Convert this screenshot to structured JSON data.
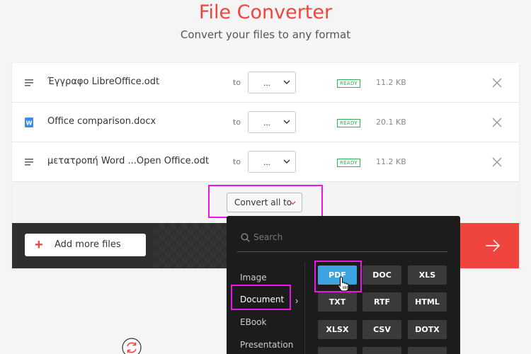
{
  "header": {
    "title": "File Converter",
    "subtitle": "Convert your files to any format"
  },
  "files": [
    {
      "name": "Έγγραφο LibreOffice.odt",
      "icon": "document-icon",
      "to_label": "to",
      "format": "...",
      "status": "READY",
      "size": "11.2 KB"
    },
    {
      "name": "Office comparison.docx",
      "icon": "word-icon",
      "to_label": "to",
      "format": "...",
      "status": "READY",
      "size": "20.1 KB"
    },
    {
      "name": "μετατροπή Word ...Open Office.odt",
      "icon": "document-icon",
      "to_label": "to",
      "format": "...",
      "status": "READY",
      "size": "11.2 KB"
    }
  ],
  "convert_all": {
    "label": "Convert all to"
  },
  "add_more": {
    "label": "Add more files"
  },
  "dropdown": {
    "search_placeholder": "Search",
    "categories": [
      "Image",
      "Document",
      "EBook",
      "Presentation"
    ],
    "active_category": "Document",
    "formats": [
      "PDF",
      "DOC",
      "XLS",
      "TXT",
      "RTF",
      "HTML",
      "XLSX",
      "CSV",
      "DOTX"
    ],
    "selected_format": "PDF"
  },
  "colors": {
    "brand": "#f0443f",
    "ready": "#2fae52",
    "selected": "#3aa3e0",
    "highlight": "#e619e6"
  }
}
